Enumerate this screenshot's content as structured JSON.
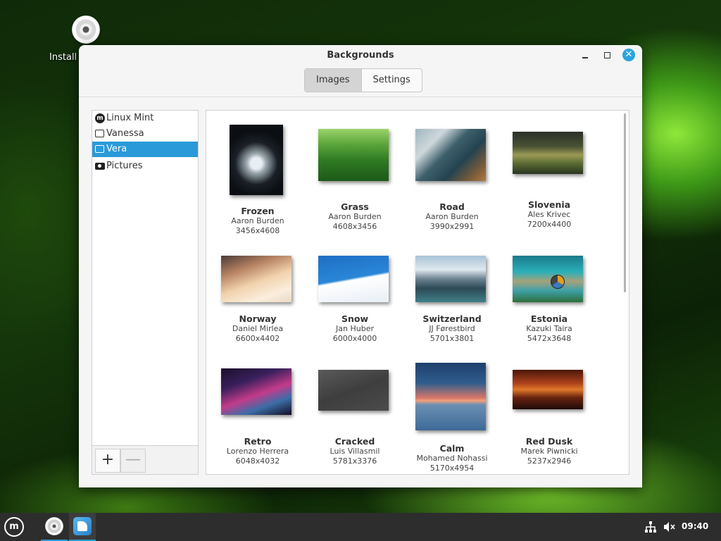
{
  "desktop": {
    "install_label": "Install"
  },
  "window": {
    "title": "Backgrounds",
    "tabs": [
      {
        "label": "Images",
        "active": true
      },
      {
        "label": "Settings",
        "active": false
      }
    ]
  },
  "sidebar": {
    "items": [
      {
        "label": "Linux Mint",
        "icon": "mint-logo-icon",
        "selected": false
      },
      {
        "label": "Vanessa",
        "icon": "monitor-icon",
        "selected": false
      },
      {
        "label": "Vera",
        "icon": "monitor-icon",
        "selected": true
      },
      {
        "label": "Pictures",
        "icon": "camera-icon",
        "selected": false
      }
    ],
    "add_label": "+",
    "remove_label": "—"
  },
  "wallpapers": [
    {
      "name": "Frozen",
      "author": "Aaron Burden",
      "size": "3456x4608"
    },
    {
      "name": "Grass",
      "author": "Aaron Burden",
      "size": "4608x3456"
    },
    {
      "name": "Road",
      "author": "Aaron Burden",
      "size": "3990x2991"
    },
    {
      "name": "Slovenia",
      "author": "Ales Krivec",
      "size": "7200x4400"
    },
    {
      "name": "Norway",
      "author": "Daniel Mirlea",
      "size": "6600x4402"
    },
    {
      "name": "Snow",
      "author": "Jan Huber",
      "size": "6000x4000"
    },
    {
      "name": "Switzerland",
      "author": "JJ Førestbird",
      "size": "5701x3801"
    },
    {
      "name": "Estonia",
      "author": "Kazuki Taira",
      "size": "5472x3648"
    },
    {
      "name": "Retro",
      "author": "Lorenzo Herrera",
      "size": "6048x4032"
    },
    {
      "name": "Cracked",
      "author": "Luis Villasmil",
      "size": "5781x3376"
    },
    {
      "name": "Calm",
      "author": "Mohamed Nohassi",
      "size": "5170x4954"
    },
    {
      "name": "Red Dusk",
      "author": "Marek Piwnicki",
      "size": "5237x2946"
    }
  ],
  "taskbar": {
    "menu_label": "m",
    "clock": "09:40"
  }
}
